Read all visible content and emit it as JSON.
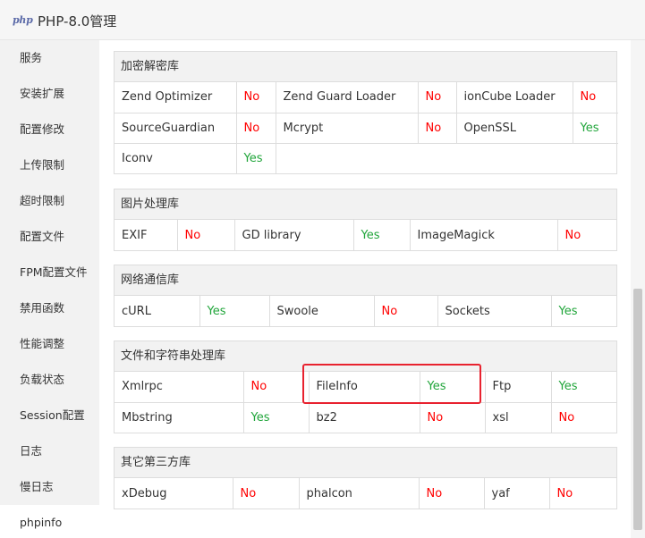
{
  "window": {
    "logo": "php",
    "title": "PHP-8.0管理"
  },
  "sidebar": {
    "items": [
      "服务",
      "安装扩展",
      "配置修改",
      "上传限制",
      "超时限制",
      "配置文件",
      "FPM配置文件",
      "禁用函数",
      "性能调整",
      "负载状态",
      "Session配置",
      "日志",
      "慢日志",
      "phpinfo"
    ],
    "active": "phpinfo"
  },
  "sections": {
    "s0": {
      "title": "加密解密库",
      "rows": [
        [
          {
            "name": "Zend Optimizer",
            "status": "No"
          },
          {
            "name": "Zend Guard Loader",
            "status": "No"
          },
          {
            "name": "ionCube Loader",
            "status": "No"
          }
        ],
        [
          {
            "name": "SourceGuardian",
            "status": "No"
          },
          {
            "name": "Mcrypt",
            "status": "No"
          },
          {
            "name": "OpenSSL",
            "status": "Yes"
          }
        ],
        [
          {
            "name": "Iconv",
            "status": "Yes"
          }
        ]
      ]
    },
    "s1": {
      "title": "图片处理库",
      "rows": [
        [
          {
            "name": "EXIF",
            "status": "No"
          },
          {
            "name": "GD library",
            "status": "Yes"
          },
          {
            "name": "ImageMagick",
            "status": "No"
          }
        ]
      ]
    },
    "s2": {
      "title": "网络通信库",
      "rows": [
        [
          {
            "name": "cURL",
            "status": "Yes"
          },
          {
            "name": "Swoole",
            "status": "No"
          },
          {
            "name": "Sockets",
            "status": "Yes"
          }
        ]
      ]
    },
    "s3": {
      "title": "文件和字符串处理库",
      "rows": [
        [
          {
            "name": "Xmlrpc",
            "status": "No"
          },
          {
            "name": "FileInfo",
            "status": "Yes"
          },
          {
            "name": "Ftp",
            "status": "Yes"
          }
        ],
        [
          {
            "name": "Mbstring",
            "status": "Yes"
          },
          {
            "name": "bz2",
            "status": "No"
          },
          {
            "name": "xsl",
            "status": "No"
          }
        ]
      ]
    },
    "s4": {
      "title": "其它第三方库",
      "rows": [
        [
          {
            "name": "xDebug",
            "status": "No"
          },
          {
            "name": "phalcon",
            "status": "No"
          },
          {
            "name": "yaf",
            "status": "No"
          }
        ]
      ]
    }
  },
  "colors": {
    "yes": "#20a53a",
    "no": "#ff0000",
    "highlight": "#e8222f"
  }
}
